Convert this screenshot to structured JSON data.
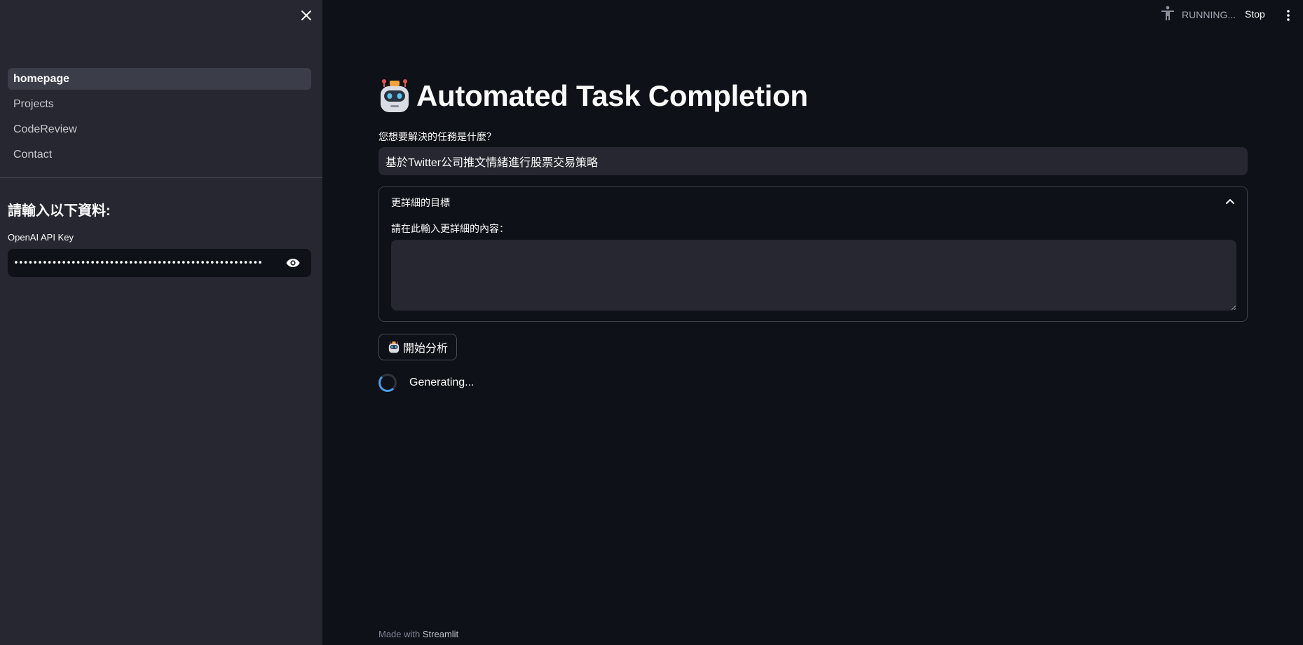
{
  "sidebar": {
    "close_icon": "close-icon",
    "nav": [
      {
        "label": "homepage",
        "active": true
      },
      {
        "label": "Projects",
        "active": false
      },
      {
        "label": "CodeReview",
        "active": false
      },
      {
        "label": "Contact",
        "active": false
      }
    ],
    "heading": "請輸入以下資料:",
    "api_key_label": "OpenAI API Key",
    "api_key_value": "••••••••••••••••••••••••••••••••••••••••••••••••••••",
    "visibility_icon": "eye-icon"
  },
  "header": {
    "status_icon": "accessibility-icon",
    "status_label": "RUNNING...",
    "stop_label": "Stop",
    "menu_icon": "kebab-menu-icon"
  },
  "main": {
    "title_icon": "robot-icon",
    "title": "Automated Task Completion",
    "task_label": "您想要解決的任務是什麼？",
    "task_value": "基於Twitter公司推文情緒進行股票交易策略",
    "expander": {
      "header": "更詳細的目標",
      "chevron_icon": "chevron-up-icon",
      "detail_label": "請在此輸入更詳細的內容：",
      "detail_value": ""
    },
    "analyze_button": {
      "icon": "robot-icon",
      "label": "開始分析"
    },
    "spinner_text": "Generating..."
  },
  "footer": {
    "prefix": "Made with",
    "brand": "Streamlit"
  },
  "colors": {
    "background": "#0e1117",
    "sidebar": "#262730",
    "input": "#262730",
    "spinner_accent": "#4a9ee8"
  }
}
